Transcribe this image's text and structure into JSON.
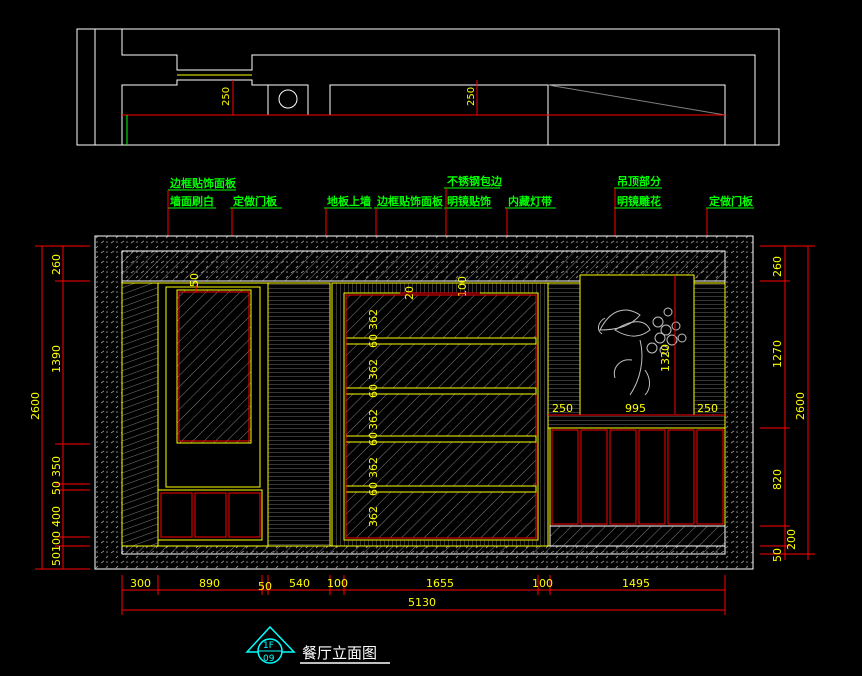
{
  "title": "餐厅立面图",
  "symbol": {
    "top": "1F",
    "bottom": "09"
  },
  "labels": {
    "frame_panel_1": "边框贴饰面板",
    "wall_paint": "墙面刷白",
    "custom_door_1": "定做门板",
    "floor_up_wall": "地板上墙",
    "frame_panel_2": "边框贴饰面板",
    "steel_edge": "不锈钢包边",
    "mirror": "明镜贴饰",
    "light_strip": "内藏灯带",
    "ceiling_part": "吊顶部分",
    "etched_mirror": "明镜雕花",
    "custom_door_2": "定做门板"
  },
  "dims": {
    "plan_250a": "250",
    "plan_250b": "250",
    "left_260": "260",
    "left_1390": "1390",
    "left_350": "350",
    "left_50": "50",
    "left_400": "400",
    "left_100": "100",
    "left_50b": "50",
    "left_2600": "2600",
    "right_260": "260",
    "right_1270": "1270",
    "right_820": "820",
    "right_200": "200",
    "right_50": "50",
    "right_2600": "2600",
    "b_300": "300",
    "b_890": "890",
    "b_50": "50",
    "b_540": "540",
    "b_100a": "100",
    "b_1655": "1655",
    "b_100b": "100",
    "b_1495": "1495",
    "b_total": "5130",
    "in_50": "50",
    "in_20": "20",
    "in_100": "100",
    "shelf_362a": "362",
    "shelf_60a": "60",
    "shelf_362b": "362",
    "shelf_60b": "60",
    "shelf_362c": "362",
    "shelf_60c": "60",
    "shelf_362d": "362",
    "shelf_60d": "60",
    "shelf_362e": "362",
    "win_1320": "1320",
    "win_250a": "250",
    "win_995": "995",
    "win_250b": "250"
  },
  "colors": {
    "bg": "#000000",
    "line_white": "#ffffff",
    "yellow": "#ffff00",
    "red": "#ff0000",
    "green": "#00ff00",
    "cyan": "#00ffff",
    "gray": "#808080"
  }
}
